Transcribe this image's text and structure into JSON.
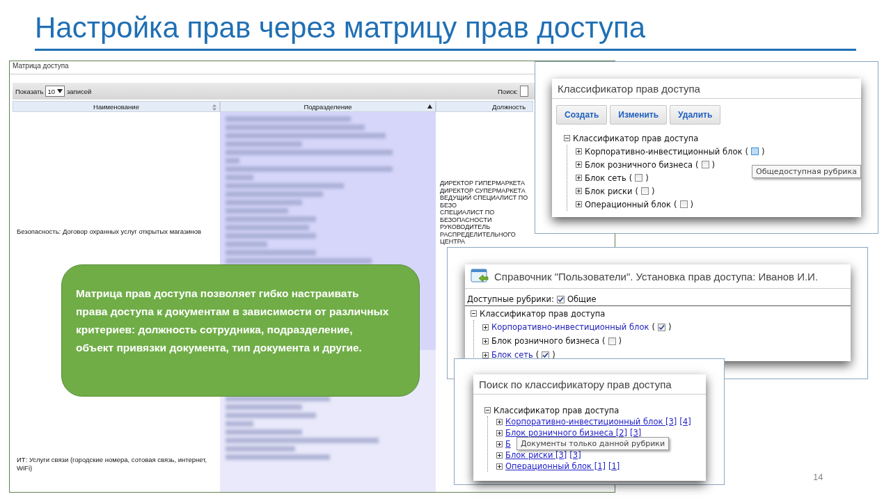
{
  "slide": {
    "title": "Настройка прав через матрицу прав доступа",
    "page_number": "14"
  },
  "matrix_panel": {
    "title": "Матрица доступа",
    "show_label": "Показать",
    "page_size": "10",
    "records_label": "записей",
    "search_label": "Поиск:",
    "columns": [
      {
        "label": "Наименование",
        "sorted": false
      },
      {
        "label": "Подразделение",
        "sorted": true
      },
      {
        "label": "Должность"
      }
    ],
    "rows": [
      {
        "name": "Безопасность: Договор охранных услуг открытых магазинов",
        "positions": [
          "ДИРЕКТОР ГИПЕРМАРКЕТА",
          "ДИРЕКТОР СУПЕРМАРКЕТА",
          "ВЕДУЩИЙ СПЕЦИАЛИСТ ПО БЕЗО",
          "СПЕЦИАЛИСТ ПО БЕЗОПАСНОСТИ",
          "РУКОВОДИТЕЛЬ РАСПРЕДЕЛИТЕЛЬНОГО ЦЕНТРА"
        ]
      },
      {
        "name": "ИТ: Услуги связи (городские номера, сотовая связь, интернет, WiFi)",
        "positions": []
      }
    ]
  },
  "callout": {
    "text": "Матрица прав доступа позволяет гибко настраивать права доступа к документам в зависимости от различных критериев: должность сотрудника, подразделение, объект привязки документа, тип документа и другие."
  },
  "classifier_panel": {
    "title": "Классификатор прав доступа",
    "buttons": [
      "Создать",
      "Изменить",
      "Удалить"
    ],
    "tooltip": "Общедоступная рубрика",
    "tree": {
      "label": "Классификатор прав доступа",
      "expanded": true,
      "children": [
        {
          "label": "Корпоративно-инвестиционный блок",
          "open": "(",
          "checked": false,
          "hovered": true,
          "close": ")"
        },
        {
          "label": "Блок розничного бизнеса",
          "open": "(",
          "checked": false,
          "hovered": false,
          "close": ")"
        },
        {
          "label": "Блок сеть",
          "open": "(",
          "checked": false,
          "hovered": false,
          "close": ")"
        },
        {
          "label": "Блок риски",
          "open": "(",
          "checked": false,
          "hovered": false,
          "close": ")"
        },
        {
          "label": "Операционный блок",
          "open": "(",
          "checked": false,
          "hovered": false,
          "close": ")"
        }
      ]
    }
  },
  "user_rights_panel": {
    "title": "Справочник \"Пользователи\". Установка прав доступа: Иванов И.И.",
    "available_label": "Доступные рубрики:",
    "common_checked": true,
    "common_label": "Общие",
    "tree": {
      "label": "Классификатор прав доступа",
      "expanded": true,
      "children": [
        {
          "label": "Корпоративно-инвестиционный блок",
          "open": "(",
          "checked": true,
          "close": ")"
        },
        {
          "label": "Блок розничного бизнеса",
          "open": "(",
          "checked": false,
          "close": ")"
        },
        {
          "label": "Блок сеть",
          "open": "(",
          "checked": true,
          "close": ")"
        }
      ]
    }
  },
  "search_panel": {
    "title": "Поиск по классификатору прав доступа",
    "tooltip": "Документы только данной рубрики",
    "tree": {
      "label": "Классификатор прав доступа",
      "expanded": true,
      "children": [
        {
          "label": "Корпоративно-инвестиционный блок [3]",
          "count_link": "[4]"
        },
        {
          "label": "Блок розничного бизнеса [2]",
          "count_link": "[3]"
        },
        {
          "label": "Б"
        },
        {
          "label": "Блок риски [3]",
          "count_link": "[3]"
        },
        {
          "label": "Операционный блок [1]",
          "count_link": "[1]"
        }
      ]
    }
  }
}
